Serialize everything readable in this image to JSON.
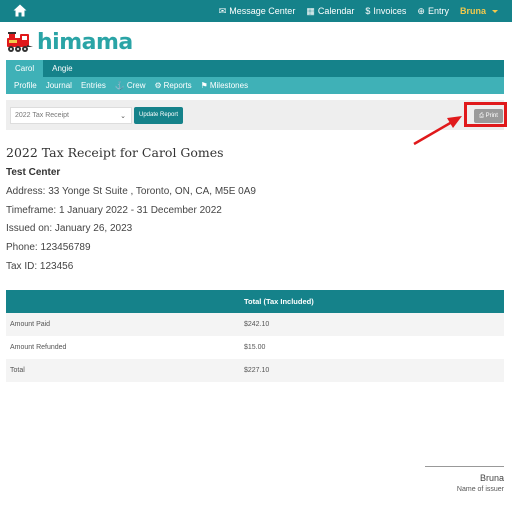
{
  "topbar": {
    "home_icon": "home-icon",
    "nav": [
      {
        "icon": "envelope-icon",
        "glyph": "✉",
        "label": "Message Center"
      },
      {
        "icon": "calendar-icon",
        "glyph": "▦",
        "label": "Calendar"
      },
      {
        "icon": "dollar-icon",
        "glyph": "$",
        "label": "Invoices"
      },
      {
        "icon": "plus-circle-icon",
        "glyph": "⊕",
        "label": "Entry"
      }
    ],
    "user": "Bruna",
    "colors": {
      "bar": "#15828a",
      "user": "#f2c94c"
    }
  },
  "logo": {
    "text": "himama",
    "color": "#2aa4a6"
  },
  "child_tabs": [
    {
      "label": "Carol",
      "active": true
    },
    {
      "label": "Angie",
      "active": false
    }
  ],
  "subnav": [
    {
      "label": "Profile",
      "icon": ""
    },
    {
      "label": "Journal",
      "icon": ""
    },
    {
      "label": "Entries",
      "icon": ""
    },
    {
      "label": "Crew",
      "icon": "anchor-icon",
      "glyph": "⚓"
    },
    {
      "label": "Reports",
      "icon": "sitemap-icon",
      "glyph": "⚙"
    },
    {
      "label": "Milestones",
      "icon": "flag-icon",
      "glyph": "⚑"
    }
  ],
  "toolbar": {
    "year_selected": "2022 Tax Receipt",
    "update_label": "Update Report",
    "print_label": "Print",
    "print_icon": "print-icon"
  },
  "receipt": {
    "title": "2022 Tax Receipt for Carol Gomes",
    "center_name": "Test Center",
    "address": "Address: 33 Yonge St Suite , Toronto, ON, CA, M5E 0A9",
    "timeframe": "Timeframe: 1 January 2022 - 31 December 2022",
    "issued": "Issued on: January 26, 2023",
    "phone": "Phone: 123456789",
    "tax_id": "Tax ID: 123456"
  },
  "table": {
    "headers": [
      "",
      "Total (Tax Included)"
    ],
    "rows": [
      [
        "Amount Paid",
        "$242.10"
      ],
      [
        "Amount Refunded",
        "$15.00"
      ],
      [
        "Total",
        "$227.10"
      ]
    ]
  },
  "signature": {
    "name": "Bruna",
    "caption": "Name of issuer"
  },
  "annotation": {
    "color": "#e0191b"
  }
}
